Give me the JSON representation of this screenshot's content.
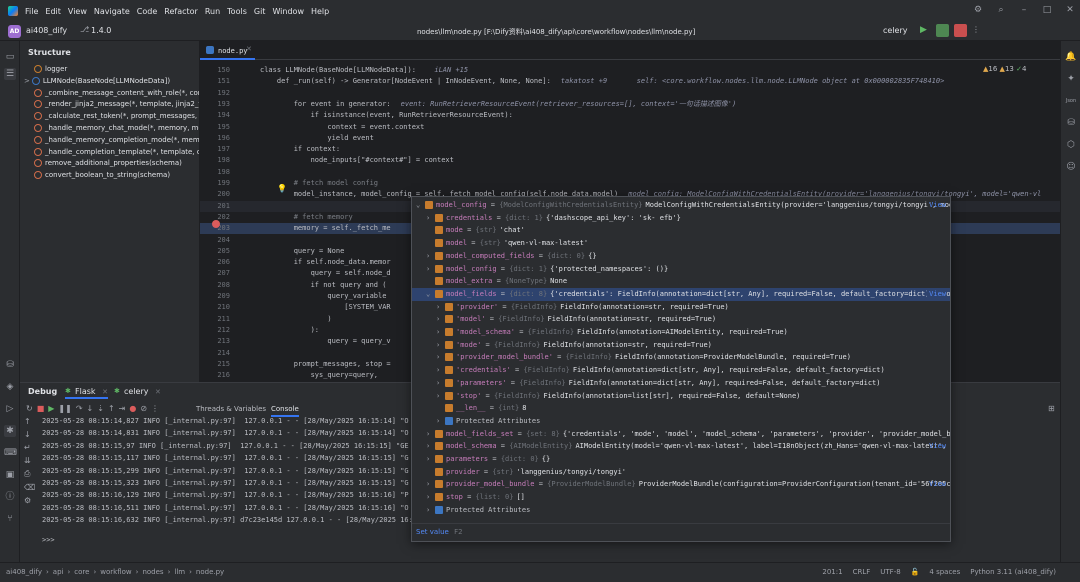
{
  "menubar": {
    "items": [
      "File",
      "Edit",
      "View",
      "Navigate",
      "Code",
      "Refactor",
      "Run",
      "Tools",
      "Git",
      "Window",
      "Help"
    ]
  },
  "toolbar": {
    "project_badge": "AD",
    "project": "ai408_dify",
    "branch": "1.4.0",
    "path": "nodes\\llm\\node.py [F:\\Dify资料\\ai408_dify\\api\\core\\workflow\\nodes\\llm\\node.py]",
    "run_config": "celery"
  },
  "structure": {
    "title": "Structure",
    "items": [
      {
        "icon": "f",
        "label": "logger"
      },
      {
        "icon": "C",
        "label": "LLMNode(BaseNode[LLMNodeData])"
      },
      {
        "icon": "m",
        "label": "_combine_message_content_with_role(*, contents="
      },
      {
        "icon": "m",
        "label": "_render_jinja2_message(*, template, jinja2_variable"
      },
      {
        "icon": "m",
        "label": "_calculate_rest_token(*, prompt_messages, model_"
      },
      {
        "icon": "m",
        "label": "_handle_memory_chat_mode(*, memory, memory_"
      },
      {
        "icon": "m",
        "label": "_handle_memory_completion_mode(*, memory, me"
      },
      {
        "icon": "m",
        "label": "_handle_completion_template(*, template, context"
      },
      {
        "icon": "m",
        "label": "remove_additional_properties(schema)"
      },
      {
        "icon": "m",
        "label": "convert_boolean_to_string(schema)"
      }
    ]
  },
  "editor": {
    "tab": "node.py",
    "inspections": {
      "warnings": "16",
      "weak": "13",
      "ok": "4"
    },
    "lines": [
      {
        "n": "150",
        "t": "class LLMNode(BaseNode[LLMNodeData]):  ",
        "hint": "iLAN +15"
      },
      {
        "n": "151",
        "t": "    def _run(self) -> Generator[NodeEvent | InNodeEvent, None, None]:",
        "hint": "takatost +9       self: <core.workflow.nodes.llm.node.LLMNode object at 0x000002835F748410>"
      },
      {
        "n": "192",
        "t": "",
        "hint": ""
      },
      {
        "n": "193",
        "t": "        for event in generator:",
        "hint": "event: RunRetrieverResourceEvent(retriever_resources=[], context='一句话描述图像')"
      },
      {
        "n": "194",
        "t": "            if isinstance(event, RunRetrieverResourceEvent):",
        "hint": ""
      },
      {
        "n": "195",
        "t": "                context = event.context",
        "hint": ""
      },
      {
        "n": "196",
        "t": "                yield event",
        "hint": ""
      },
      {
        "n": "197",
        "t": "        if context:",
        "hint": ""
      },
      {
        "n": "198",
        "t": "            node_inputs[\"#context#\"] = context",
        "hint": ""
      },
      {
        "n": "198",
        "t": "",
        "hint": ""
      },
      {
        "n": "199",
        "t": "        # fetch model config",
        "hint": ""
      },
      {
        "n": "200",
        "t": "        model_instance, model_config = self._fetch_model_config(self.node_data.model)",
        "hint": "model_config: ModelConfigWithCredentialsEntity(provider='langgenius/tongyi/tongyi', model='qwen-vl"
      },
      {
        "n": "201",
        "t": "",
        "hint": ""
      },
      {
        "n": "202",
        "t": "        # fetch memory",
        "hint": ""
      },
      {
        "n": "203",
        "t": "        memory = self._fetch_me",
        "hint": ""
      },
      {
        "n": "204",
        "t": "",
        "hint": ""
      },
      {
        "n": "205",
        "t": "        query = None",
        "hint": ""
      },
      {
        "n": "206",
        "t": "        if self.node_data.memor",
        "hint": ""
      },
      {
        "n": "207",
        "t": "            query = self.node_d",
        "hint": ""
      },
      {
        "n": "208",
        "t": "            if not query and (",
        "hint": ""
      },
      {
        "n": "209",
        "t": "                query_variable ",
        "hint": ""
      },
      {
        "n": "210",
        "t": "                    [SYSTEM_VAR",
        "hint": ""
      },
      {
        "n": "211",
        "t": "                )",
        "hint": ""
      },
      {
        "n": "212",
        "t": "            ):",
        "hint": ""
      },
      {
        "n": "213",
        "t": "                query = query_v",
        "hint": ""
      },
      {
        "n": "214",
        "t": "",
        "hint": ""
      },
      {
        "n": "215",
        "t": "        prompt_messages, stop =",
        "hint": ""
      },
      {
        "n": "216",
        "t": "            sys_query=query,",
        "hint": ""
      }
    ]
  },
  "popup": {
    "rows": [
      {
        "ind": 0,
        "arrow": "v",
        "key": "model_config",
        "typ": "{ModelConfigWithCredentialsEntity}",
        "val": "ModelConfigWithCredentialsEntity(provider='langgenius/tongyi/tongyi', model='qwen-vl-max-latest', mo...",
        "view": "View"
      },
      {
        "ind": 1,
        "arrow": ">",
        "key": "credentials",
        "typ": "{dict: 1}",
        "val": "{'dashscope_api_key': 'sk-                                           efb'}",
        "view": ""
      },
      {
        "ind": 1,
        "arrow": "",
        "key": "mode",
        "typ": "{str}",
        "val": "'chat'",
        "view": ""
      },
      {
        "ind": 1,
        "arrow": "",
        "key": "model",
        "typ": "{str}",
        "val": "'qwen-vl-max-latest'",
        "view": ""
      },
      {
        "ind": 1,
        "arrow": ">",
        "key": "model_computed_fields",
        "typ": "{dict: 0}",
        "val": "{}",
        "view": ""
      },
      {
        "ind": 1,
        "arrow": ">",
        "key": "model_config",
        "typ": "{dict: 1}",
        "val": "{'protected_namespaces': ()}",
        "view": ""
      },
      {
        "ind": 1,
        "arrow": "",
        "key": "model_extra",
        "typ": "{NoneType}",
        "val": "None",
        "view": ""
      },
      {
        "ind": 1,
        "arrow": "v",
        "key": "model_fields",
        "typ": "{dict: 8}",
        "val": "{'credentials': FieldInfo(annotation=dict[str, Any], required=False, default_factory=dict), 'mode': FieldInfo(annotation=str, required=T...",
        "view": "View"
      },
      {
        "ind": 2,
        "arrow": ">",
        "key": "'provider'",
        "typ": "{FieldInfo}",
        "val": "FieldInfo(annotation=str, required=True)",
        "view": ""
      },
      {
        "ind": 2,
        "arrow": ">",
        "key": "'model'",
        "typ": "{FieldInfo}",
        "val": "FieldInfo(annotation=str, required=True)",
        "view": ""
      },
      {
        "ind": 2,
        "arrow": ">",
        "key": "'model_schema'",
        "typ": "{FieldInfo}",
        "val": "FieldInfo(annotation=AIModelEntity, required=True)",
        "view": ""
      },
      {
        "ind": 2,
        "arrow": ">",
        "key": "'mode'",
        "typ": "{FieldInfo}",
        "val": "FieldInfo(annotation=str, required=True)",
        "view": ""
      },
      {
        "ind": 2,
        "arrow": ">",
        "key": "'provider_model_bundle'",
        "typ": "{FieldInfo}",
        "val": "FieldInfo(annotation=ProviderModelBundle, required=True)",
        "view": ""
      },
      {
        "ind": 2,
        "arrow": ">",
        "key": "'credentials'",
        "typ": "{FieldInfo}",
        "val": "FieldInfo(annotation=dict[str, Any], required=False, default_factory=dict)",
        "view": ""
      },
      {
        "ind": 2,
        "arrow": ">",
        "key": "'parameters'",
        "typ": "{FieldInfo}",
        "val": "FieldInfo(annotation=dict[str, Any], required=False, default_factory=dict)",
        "view": ""
      },
      {
        "ind": 2,
        "arrow": ">",
        "key": "'stop'",
        "typ": "{FieldInfo}",
        "val": "FieldInfo(annotation=list[str], required=False, default=None)",
        "view": ""
      },
      {
        "ind": 2,
        "arrow": "",
        "key": "__len__",
        "typ": "{int}",
        "val": "8",
        "view": ""
      },
      {
        "ind": 2,
        "arrow": ">",
        "key": "Protected Attributes",
        "typ": "",
        "val": "",
        "view": ""
      },
      {
        "ind": 1,
        "arrow": ">",
        "key": "model_fields_set",
        "typ": "{set: 8}",
        "val": "{'credentials', 'mode', 'model', 'model_schema', 'parameters', 'provider', 'provider_model_bundle', 'stop'}",
        "view": ""
      },
      {
        "ind": 1,
        "arrow": ">",
        "key": "model_schema",
        "typ": "{AIModelEntity}",
        "val": "AIModelEntity(model='qwen-vl-max-latest', label=I18nObject(zh_Hans='qwen-vl-max-latest', en_US='qwen-vl-max-latest'...",
        "view": "View"
      },
      {
        "ind": 1,
        "arrow": ">",
        "key": "parameters",
        "typ": "{dict: 0}",
        "val": "{}",
        "view": ""
      },
      {
        "ind": 1,
        "arrow": "",
        "key": "provider",
        "typ": "{str}",
        "val": "'langgenius/tongyi/tongyi'",
        "view": ""
      },
      {
        "ind": 1,
        "arrow": ">",
        "key": "provider_model_bundle",
        "typ": "{ProviderModelBundle}",
        "val": "ProviderModelBundle(configuration=ProviderConfiguration(tenant_id='56f205c6-6d2c-45b5-8584-483b5...",
        "view": "View"
      },
      {
        "ind": 1,
        "arrow": ">",
        "key": "stop",
        "typ": "{list: 0}",
        "val": "[]",
        "view": ""
      },
      {
        "ind": 1,
        "arrow": ">",
        "key": "Protected Attributes",
        "typ": "",
        "val": "",
        "view": ""
      }
    ],
    "footer": "Set value",
    "footer_key": "F2"
  },
  "debug": {
    "title": "Debug",
    "tabs": [
      "Flask",
      "celery"
    ],
    "subtabs": [
      "Threads & Variables",
      "Console"
    ],
    "logs": [
      "2025-05-28 08:15:14,827 INFO [_internal.py:97]  127.0.0.1 - - [28/May/2025 16:15:14] \"O",
      "2025-05-28 08:15:14,831 INFO [_internal.py:97]  127.0.0.1 - - [28/May/2025 16:15:14] \"O",
      "2025-05-28 08:15:15,97 INFO [_internal.py:97]  127.0.0.1 - - [28/May/2025 16:15:15] \"GE",
      "2025-05-28 08:15:15,117 INFO [_internal.py:97]  127.0.0.1 - - [28/May/2025 16:15:15] \"G",
      "2025-05-28 08:15:15,299 INFO [_internal.py:97]  127.0.0.1 - - [28/May/2025 16:15:15] \"G",
      "2025-05-28 08:15:15,323 INFO [_internal.py:97]  127.0.0.1 - - [28/May/2025 16:15:15] \"G",
      "2025-05-28 08:15:16,129 INFO [_internal.py:97]  127.0.0.1 - - [28/May/2025 16:15:16] \"P",
      "2025-05-28 08:15:16,511 INFO [_internal.py:97]  127.0.0.1 - - [28/May/2025 16:15:16] \"O",
      "2025-05-28 08:15:16,632 INFO [_internal.py:97] d7c23e145d 127.0.0.1 - - [28/May/2025 16:15:16] \""
    ],
    "prompt": ">>>"
  },
  "statusbar": {
    "breadcrumb": [
      "ai408_dify",
      "api",
      "core",
      "workflow",
      "nodes",
      "llm",
      "node.py"
    ],
    "position": "201:1",
    "line_sep": "CRLF",
    "encoding": "UTF-8",
    "indent": "4 spaces",
    "interpreter": "Python 3.11 (ai408_dify)"
  }
}
